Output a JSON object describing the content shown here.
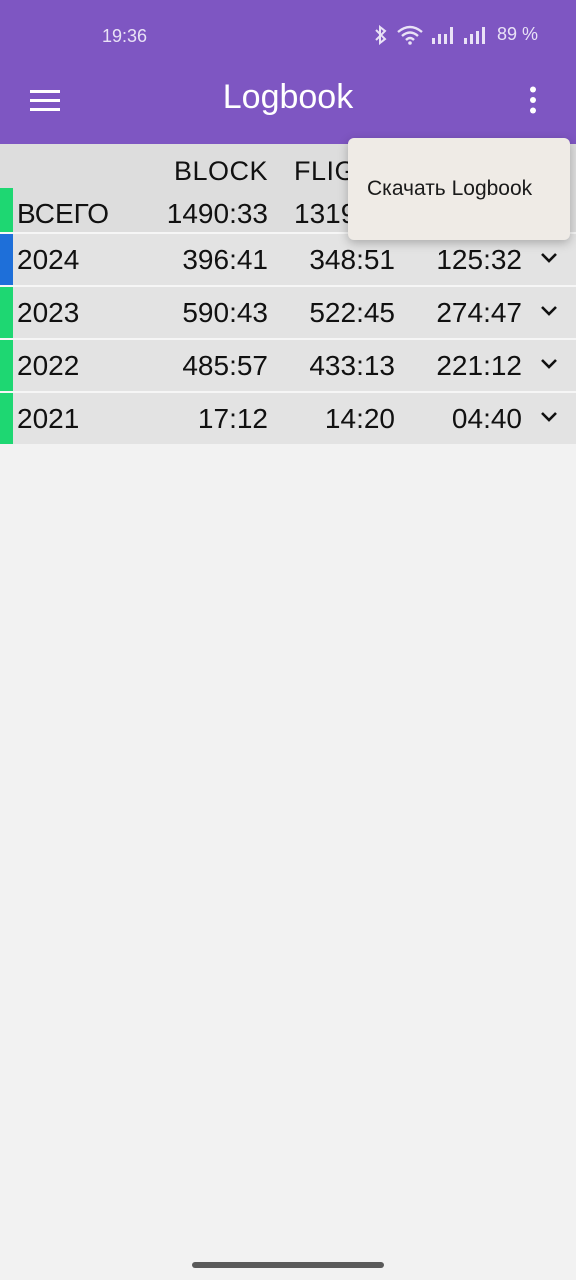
{
  "status_bar": {
    "time": "19:36",
    "battery": "89 %",
    "icons": [
      "bluetooth-icon",
      "wifi-icon",
      "signal-icon",
      "signal-icon"
    ]
  },
  "app_bar": {
    "title": "Logbook",
    "menu_icon": "hamburger-menu-icon",
    "more_icon": "more-vert-icon",
    "color": "#7e56c2"
  },
  "table": {
    "columns": [
      "BLOCK",
      "FLIG"
    ],
    "rows": [
      {
        "label": "ВСЕГО",
        "block": "1490:33",
        "flight": "1319",
        "third": "",
        "bar_color": "#1ed772"
      },
      {
        "label": "2024",
        "block": "396:41",
        "flight": "348:51",
        "third": "125:32",
        "bar_color": "#1e6fd9"
      },
      {
        "label": "2023",
        "block": "590:43",
        "flight": "522:45",
        "third": "274:47",
        "bar_color": "#1ed772"
      },
      {
        "label": "2022",
        "block": "485:57",
        "flight": "433:13",
        "third": "221:12",
        "bar_color": "#1ed772"
      },
      {
        "label": "2021",
        "block": "17:12",
        "flight": "14:20",
        "third": "04:40",
        "bar_color": "#1ed772"
      }
    ]
  },
  "popup_menu": {
    "items": [
      "Скачать Logbook"
    ]
  }
}
